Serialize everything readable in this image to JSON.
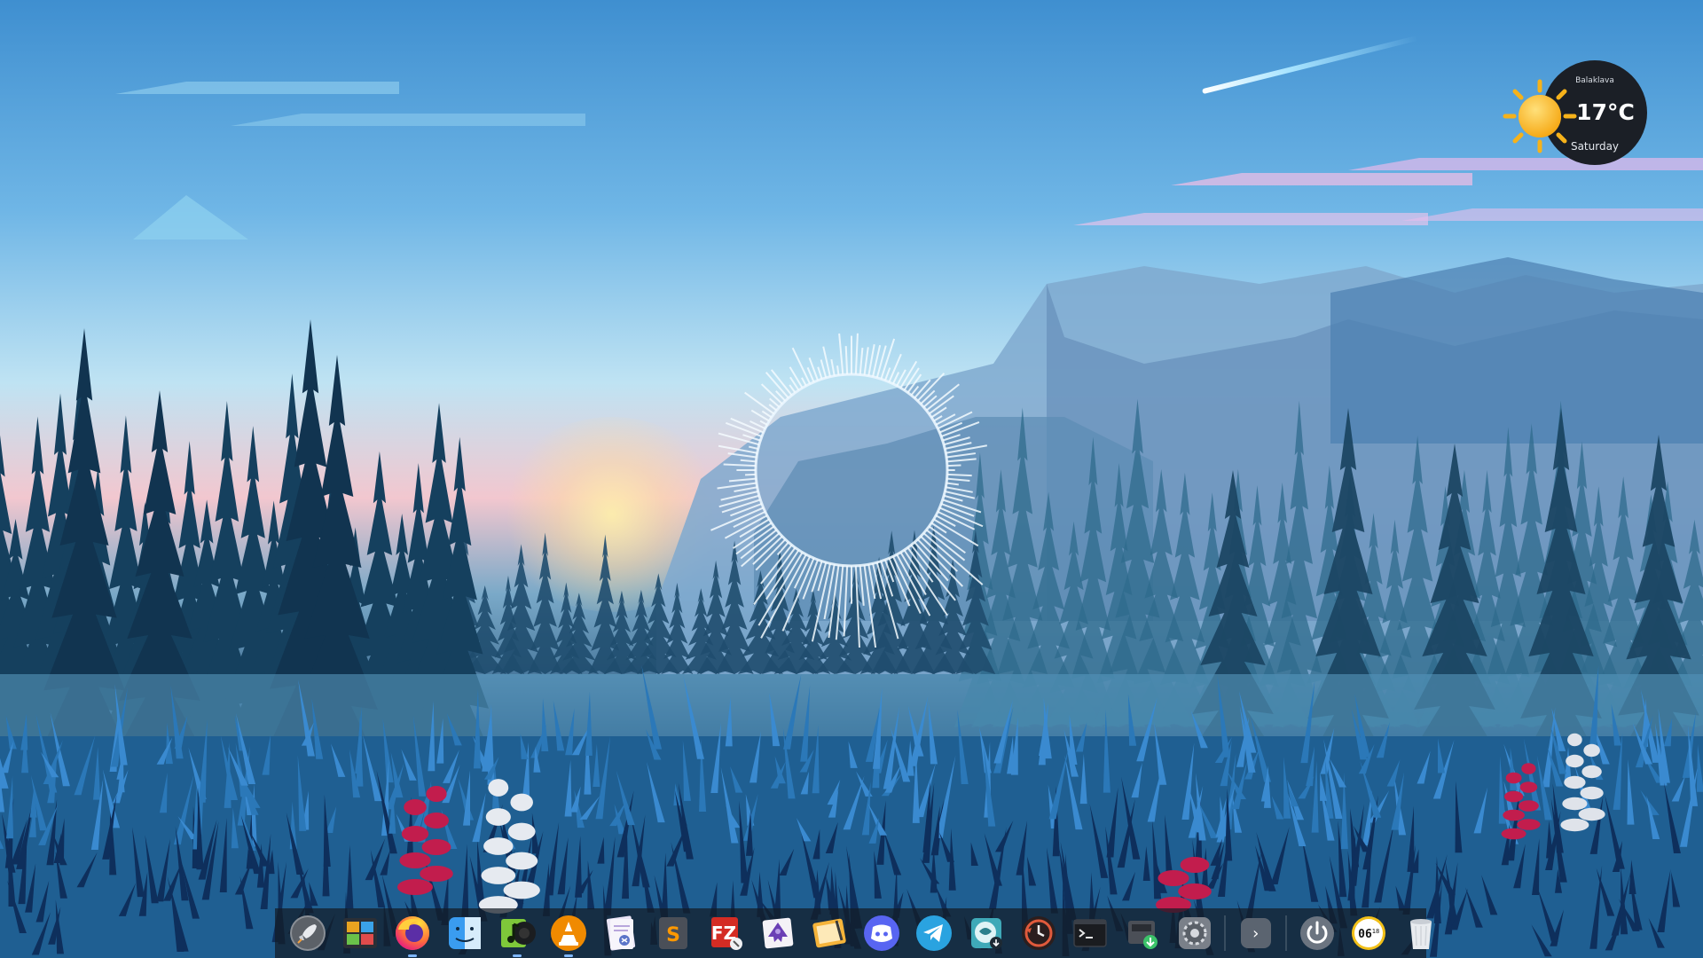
{
  "weather": {
    "city": "Balaklava",
    "temperature": "17°C",
    "day": "Saturday",
    "condition_icon": "sun-icon"
  },
  "dock": {
    "items": [
      {
        "name": "launchpad",
        "icon": "rocket-icon",
        "running": false
      },
      {
        "name": "workspaces",
        "icon": "workspace-grid-icon",
        "running": false
      },
      {
        "name": "firefox",
        "icon": "firefox-icon",
        "running": true
      },
      {
        "name": "finder",
        "icon": "finder-icon",
        "running": false
      },
      {
        "name": "music-player",
        "icon": "music-note-icon",
        "running": true
      },
      {
        "name": "vlc",
        "icon": "vlc-cone-icon",
        "running": true
      },
      {
        "name": "mail-composer",
        "icon": "letter-icon",
        "running": false
      },
      {
        "name": "sublime-text",
        "icon": "sublime-icon",
        "running": false
      },
      {
        "name": "filezilla",
        "icon": "filezilla-icon",
        "running": false
      },
      {
        "name": "inkscape",
        "icon": "inkscape-icon",
        "running": false
      },
      {
        "name": "notes",
        "icon": "notepad-icon",
        "running": false
      },
      {
        "name": "discord",
        "icon": "discord-icon",
        "running": false
      },
      {
        "name": "telegram",
        "icon": "telegram-icon",
        "running": false
      },
      {
        "name": "qbittorrent",
        "icon": "torrent-icon",
        "running": false
      },
      {
        "name": "timeshift",
        "icon": "history-clock-icon",
        "running": false
      },
      {
        "name": "terminal",
        "icon": "terminal-icon",
        "running": false
      },
      {
        "name": "package-manager",
        "icon": "download-package-icon",
        "running": false
      },
      {
        "name": "system-settings",
        "icon": "gear-icon",
        "running": false
      }
    ],
    "more_glyph": "›",
    "trailing_items": [
      {
        "name": "power",
        "icon": "power-icon"
      },
      {
        "name": "clock",
        "icon": "clock-icon",
        "time_hours": "06",
        "time_minutes": "18"
      },
      {
        "name": "trash",
        "icon": "trash-icon"
      }
    ]
  }
}
